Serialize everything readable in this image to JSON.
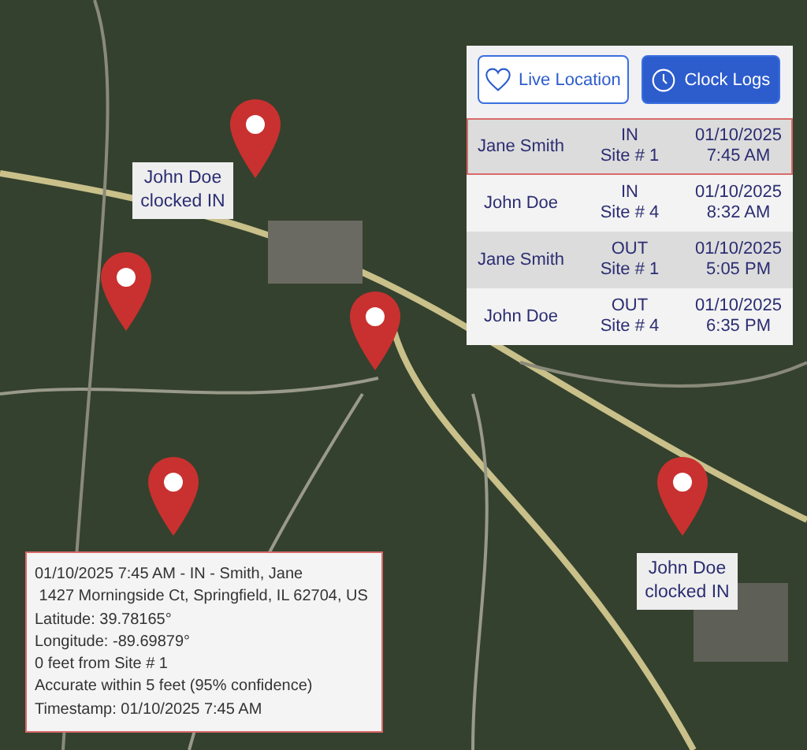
{
  "toggle_buttons": [
    {
      "label": "Live Location",
      "selected": false
    },
    {
      "label": "Clock Logs",
      "selected": true
    }
  ],
  "clock_logs": [
    {
      "name": "Jane Smith",
      "direction": "IN",
      "site": "Site # 1",
      "date": "01/10/2025",
      "time": "7:45 AM",
      "selected": true
    },
    {
      "name": "John Doe",
      "direction": "IN",
      "site": "Site # 4",
      "date": "01/10/2025",
      "time": "8:32 AM",
      "selected": false
    },
    {
      "name": "Jane Smith",
      "direction": "OUT",
      "site": "Site # 1",
      "date": "01/10/2025",
      "time": "5:05 PM",
      "selected": false
    },
    {
      "name": "John Doe",
      "direction": "OUT",
      "site": "Site # 4",
      "date": "01/10/2025",
      "time": "6:35 PM",
      "selected": false
    }
  ],
  "map_labels": [
    {
      "text": "John Doe clocked IN"
    },
    {
      "text": "John Doe clocked IN"
    }
  ],
  "detail_popup": {
    "lines": [
      "01/10/2025 7:45 AM - IN - Smith, Jane",
      " 1427 Morningside Ct, Springfield, IL 62704, US",
      "Latitude: 39.78165°",
      "Longitude: -89.69879°",
      "0 feet from Site # 1",
      "Accurate within 5 feet (95% confidence)",
      "Timestamp: 01/10/2025 7:45 AM"
    ]
  }
}
